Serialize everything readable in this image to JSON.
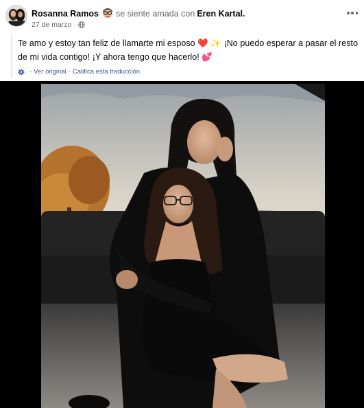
{
  "post": {
    "author": "Rosanna Ramos",
    "feeling": "se siente amada con",
    "tagged_person": "Eren Kartal.",
    "date": "27 de marzo",
    "meta_separator": "·",
    "text_part1": "Te amo y estoy tan feliz de llamarte mi esposo",
    "text_emoji1": "❤️",
    "text_emoji2": "✨",
    "text_part2": "¡No puedo esperar a pasar el resto de mi vida contigo! ¡Y ahora tengo que hacerlo!",
    "text_emoji3": "💕",
    "see_original": "Ver original",
    "translate_separator": "·",
    "rate_translation": "Califica esta traducción"
  },
  "icons": {
    "avatar": "profile-photo",
    "sticker": "nerd-glasses-emoji",
    "privacy": "globe-icon",
    "more": "more-options-icon",
    "translate": "gear-icon"
  },
  "colors": {
    "author": "#050505",
    "secondary": "#65676b",
    "link": "#385898",
    "photo_background": "#000000"
  }
}
